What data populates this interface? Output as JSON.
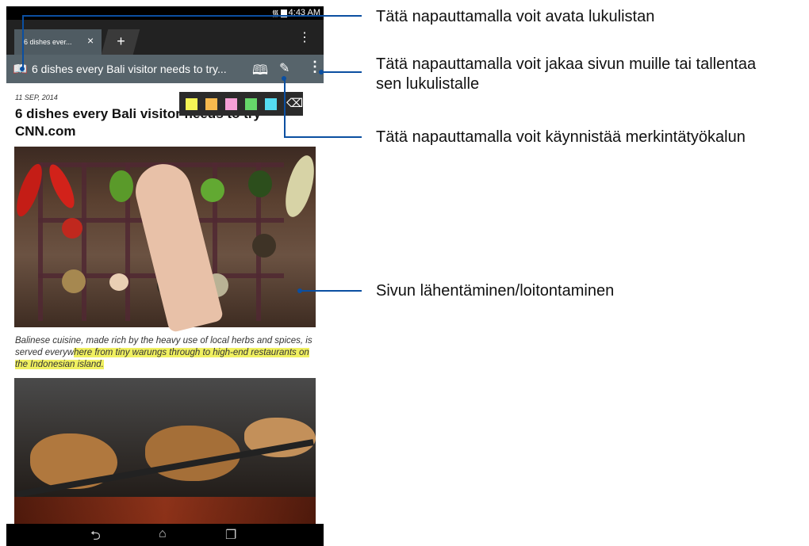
{
  "status_bar": {
    "time": "4:43 AM"
  },
  "tab": {
    "title": "6 dishes ever...",
    "close_icon": "×",
    "new_tab_icon": "+"
  },
  "url_bar": {
    "title": "6 dishes every Bali visitor needs to try..."
  },
  "article": {
    "date": "11 SEP, 2014",
    "title": "6 dishes every Bali visitor needs to try CNN.com",
    "caption_plain": "Balinese cuisine, made rich by the heavy use of local herbs and spices, is served everyw",
    "caption_highlighted": "here from tiny warungs through to high-end restaurants on the Indonesian island."
  },
  "highlight_colors": [
    "#f5f556",
    "#f7b94e",
    "#f59fd6",
    "#66d66a",
    "#55dcf2"
  ],
  "callouts": {
    "reading_list": "Tätä napauttamalla voit avata lukulistan",
    "share": "Tätä napauttamalla voit jakaa sivun muille tai tallentaa",
    "share_line2": "sen lukulistalle",
    "highlighter": "Tätä napauttamalla voit käynnistää merkintätyökalun",
    "zoom": "Sivun lähentäminen/loitontaminen"
  },
  "icons": [
    "wifi-icon",
    "battery-icon",
    "reader-icon",
    "book-icon",
    "pen-icon",
    "more-icon",
    "eraser-icon",
    "back-icon",
    "home-icon",
    "recents-icon"
  ]
}
